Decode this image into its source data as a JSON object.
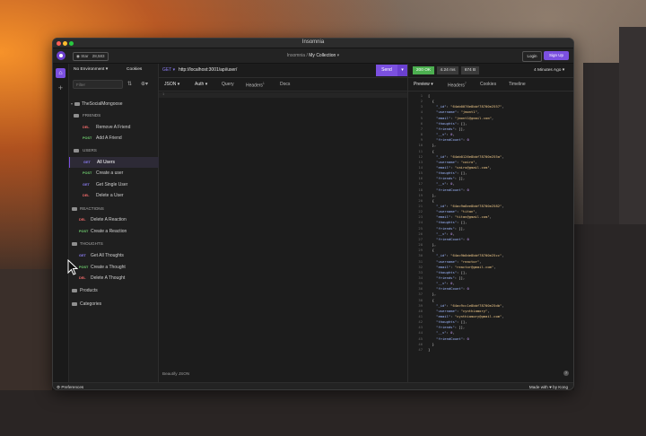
{
  "window": {
    "title": "Insomnia"
  },
  "topbar": {
    "github_label": "Star",
    "github_count": "28,583",
    "breadcrumb_project": "Insomnia",
    "breadcrumb_sep": "/",
    "breadcrumb_collection": "My Collection",
    "login": "Login",
    "signup": "Sign Up"
  },
  "sidebar": {
    "environment": "No Environment",
    "cookies": "Cookies",
    "filter_placeholder": "Filter",
    "collection": "TheSocialMongoose",
    "folders": [
      {
        "name": "FRIENDS"
      },
      {
        "name": "USERS"
      },
      {
        "name": "REACTIONS"
      },
      {
        "name": "THOUGHTS"
      },
      {
        "name": "Products"
      },
      {
        "name": "Categories"
      }
    ],
    "requests": [
      {
        "method": "DEL",
        "name": "Remove A Friend"
      },
      {
        "method": "POST",
        "name": "Add A Friend"
      },
      {
        "method": "GET",
        "name": "All Users"
      },
      {
        "method": "POST",
        "name": "Create a user"
      },
      {
        "method": "GET",
        "name": "Get Single User"
      },
      {
        "method": "DEL",
        "name": "Delete a User"
      },
      {
        "method": "DEL",
        "name": "Delete A Reaction"
      },
      {
        "method": "POST",
        "name": "Create a Reaction"
      },
      {
        "method": "GET",
        "name": "Get All Thoughts"
      },
      {
        "method": "POST",
        "name": "Create a Thought"
      },
      {
        "method": "DEL",
        "name": "Delete A Thought"
      }
    ]
  },
  "request": {
    "method": "GET",
    "url": "http://localhost:3001/api/user/",
    "send": "Send",
    "tabs": [
      "JSON",
      "Auth",
      "Query",
      "Headers",
      "Docs"
    ],
    "headers_count": "1",
    "beautify": "Beautify JSON"
  },
  "response": {
    "status": "200 OK",
    "time": "4.24 ms",
    "size": "674 B",
    "age": "4 Minutes Ago",
    "tabs": [
      "Preview",
      "Headers",
      "Cookies",
      "Timeline"
    ],
    "headers_count": "7",
    "filter_placeholder": "$.store.books[*].author",
    "lines": [
      "[",
      "  {",
      "    \"_id\": \"64ab0076e8bbf78700e2557\",",
      "    \"username\": \"jmont1\",",
      "    \"email\": \"jmont1@gmail.com\",",
      "    \"thoughts\": [],",
      "    \"friends\": [],",
      "    \"__v\": 0,",
      "    \"friendCount\": 0",
      "  },",
      "  {",
      "    \"_id\": \"64ab0126e8bbf78700e255a\",",
      "    \"username\": \"cairo\",",
      "    \"email\": \"cairo@gmail.com\",",
      "    \"thoughts\": [],",
      "    \"friends\": [],",
      "    \"__v\": 0,",
      "    \"friendCount\": 0",
      "  },",
      "  {",
      "    \"_id\": \"64ac9a8ee8bbf78700e2582\",",
      "    \"username\": \"titan\",",
      "    \"email\": \"titan@gmail.com\",",
      "    \"thoughts\": [],",
      "    \"friends\": [],",
      "    \"__v\": 0,",
      "    \"friendCount\": 0",
      "  },",
      "  {",
      "    \"_id\": \"64ac9b0de8bbf78700e25cc\",",
      "    \"username\": \"reactor\",",
      "    \"email\": \"reactor@gmail.com\",",
      "    \"thoughts\": [],",
      "    \"friends\": [],",
      "    \"__v\": 0,",
      "    \"friendCount\": 0",
      "  },",
      "  {",
      "    \"_id\": \"64ac9cc1e8bbf78700e25db\",",
      "    \"username\": \"cynthiamory\",",
      "    \"email\": \"cynthiamory@gmail.com\",",
      "    \"thoughts\": [],",
      "    \"friends\": [],",
      "    \"__v\": 0,",
      "    \"friendCount\": 0",
      "  }",
      "]"
    ]
  },
  "statusbar": {
    "preferences": "Preferences",
    "made_with": "Made with ♥ by Kong"
  }
}
